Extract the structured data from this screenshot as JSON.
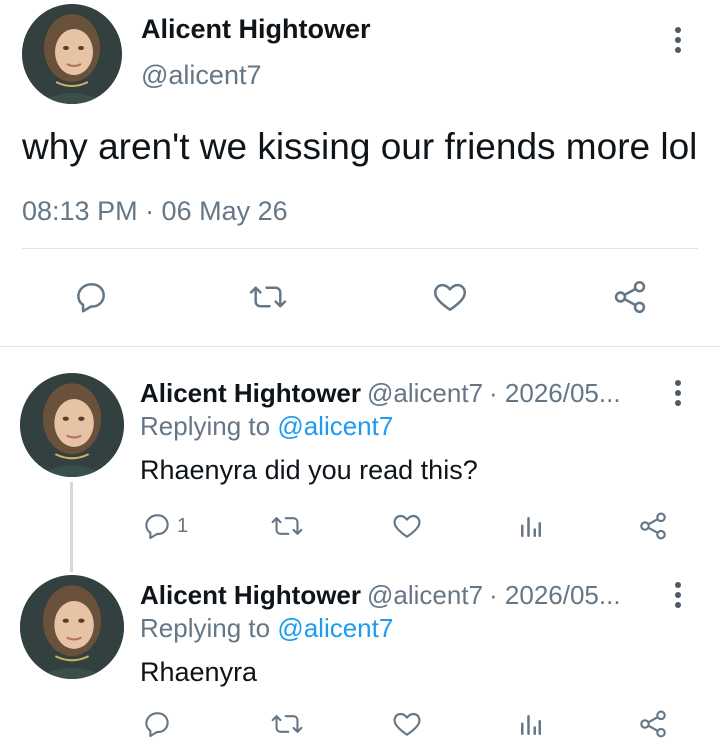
{
  "main_tweet": {
    "author_name": "Alicent Hightower",
    "handle": "@alicent7",
    "text": "why aren't we kissing our friends more lol",
    "timestamp": "08:13 PM · 06 May 26",
    "icons": {
      "more": "more-vertical-icon",
      "reply": "reply-icon",
      "retweet": "retweet-icon",
      "like": "heart-icon",
      "share": "share-icon"
    }
  },
  "replies": [
    {
      "author_name": "Alicent Hightower",
      "handle": "@alicent7",
      "date": "· 2026/05...",
      "replying_to_label": "Replying to",
      "replying_to_handle": "@alicent7",
      "text": "Rhaenyra did you read this?",
      "reply_count": "1"
    },
    {
      "author_name": "Alicent Hightower",
      "handle": "@alicent7",
      "date": "· 2026/05...",
      "replying_to_label": "Replying to",
      "replying_to_handle": "@alicent7",
      "text": "Rhaenyra",
      "reply_count": ""
    }
  ],
  "colors": {
    "text": "#0f1419",
    "muted": "#657786",
    "link": "#1d9bf0",
    "divider": "#e1e5e9"
  }
}
